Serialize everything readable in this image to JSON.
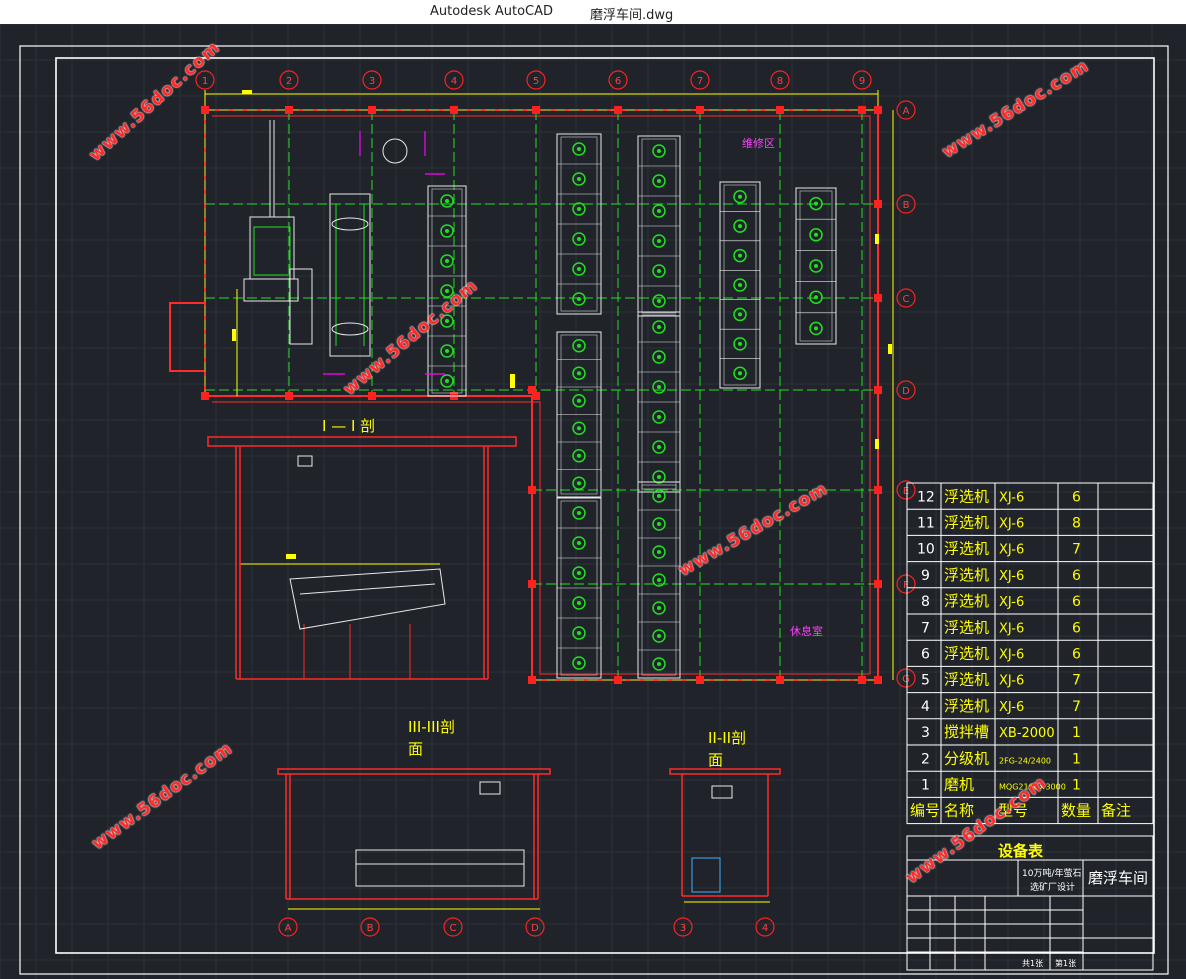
{
  "window": {
    "app_name": "Autodesk AutoCAD",
    "file_name": "磨浮车间.dwg"
  },
  "drawing": {
    "section_labels": {
      "sec1": "I — I 剖",
      "sec3_line1": "III-III剖",
      "sec3_line2": "面",
      "sec2_line1": "II-II剖",
      "sec2_line2": "面"
    },
    "area_labels": {
      "repair": "维修区",
      "rest": "休息室"
    },
    "grid_top": [
      "1",
      "2",
      "3",
      "4",
      "5",
      "6",
      "7",
      "8",
      "9"
    ],
    "grid_right": [
      "A",
      "B",
      "C",
      "D",
      "E",
      "F",
      "G"
    ],
    "grid_bottom_left": [
      "A",
      "B",
      "C",
      "D"
    ],
    "grid_bottom_right": [
      "3",
      "4"
    ]
  },
  "equipment_table": {
    "title": "设备表",
    "headers": [
      "编号",
      "名称",
      "型号",
      "数量",
      "备注"
    ],
    "rows": [
      {
        "no": "12",
        "name": "浮选机",
        "model": "XJ-6",
        "qty": "6",
        "note": ""
      },
      {
        "no": "11",
        "name": "浮选机",
        "model": "XJ-6",
        "qty": "8",
        "note": ""
      },
      {
        "no": "10",
        "name": "浮选机",
        "model": "XJ-6",
        "qty": "7",
        "note": ""
      },
      {
        "no": "9",
        "name": "浮选机",
        "model": "XJ-6",
        "qty": "6",
        "note": ""
      },
      {
        "no": "8",
        "name": "浮选机",
        "model": "XJ-6",
        "qty": "6",
        "note": ""
      },
      {
        "no": "7",
        "name": "浮选机",
        "model": "XJ-6",
        "qty": "6",
        "note": ""
      },
      {
        "no": "6",
        "name": "浮选机",
        "model": "XJ-6",
        "qty": "6",
        "note": ""
      },
      {
        "no": "5",
        "name": "浮选机",
        "model": "XJ-6",
        "qty": "7",
        "note": ""
      },
      {
        "no": "4",
        "name": "浮选机",
        "model": "XJ-6",
        "qty": "7",
        "note": ""
      },
      {
        "no": "3",
        "name": "搅拌槽",
        "model": "XB-2000",
        "qty": "1",
        "note": ""
      },
      {
        "no": "2",
        "name": "分级机",
        "model": "2FG-24/2400",
        "qty": "1",
        "note": ""
      },
      {
        "no": "1",
        "name": "磨机",
        "model": "MQG2100×3000",
        "qty": "1",
        "note": ""
      }
    ]
  },
  "title_block": {
    "project_line1": "10万吨/年萤石",
    "project_line2": "选矿厂设计",
    "drawing_name": "磨浮车间",
    "sheet_total": "共1张",
    "sheet_no": "第1张"
  },
  "watermark_text": "www.56doc.com",
  "colors": {
    "background": "#20242a",
    "grid_red": "#ff2020",
    "axis_green": "#20e020",
    "dim_yellow": "#ffff00",
    "equipment_white": "#e8e8e8",
    "accent_magenta": "#ff00ff"
  }
}
